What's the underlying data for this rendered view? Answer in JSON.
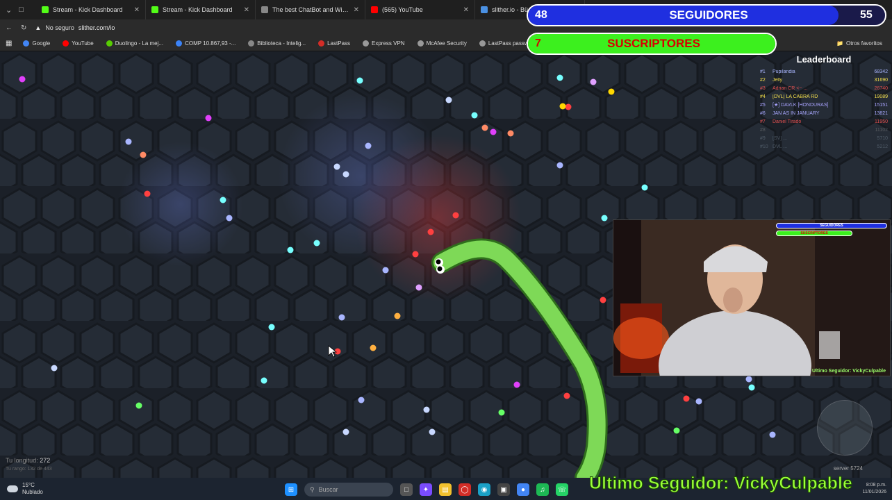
{
  "browser": {
    "tabs": [
      {
        "label": "Stream - Kick Dashboard",
        "icon": "kick-icon",
        "color": "#53fc18"
      },
      {
        "label": "Stream - Kick Dashboard",
        "icon": "kick-icon",
        "color": "#53fc18"
      },
      {
        "label": "The best ChatBot and Widgets for",
        "icon": "chatbot-icon",
        "color": "#888888"
      },
      {
        "label": "(565) YouTube",
        "icon": "youtube-icon",
        "color": "#ff0000"
      },
      {
        "label": "slither.io - Bü",
        "icon": "slither-icon",
        "color": "#4a90e2"
      }
    ],
    "address": {
      "security": "No seguro",
      "url": "slither.com/io"
    },
    "bookmarks": [
      {
        "label": "Google",
        "color": "#4285f4"
      },
      {
        "label": "YouTube",
        "color": "#ff0000"
      },
      {
        "label": "Duolingo - La mej...",
        "color": "#58cc02"
      },
      {
        "label": "COMP 10.867,93 -...",
        "color": "#3b82f6"
      },
      {
        "label": "Biblioteca - Intelig...",
        "color": "#888888"
      },
      {
        "label": "LastPass",
        "color": "#d32d27"
      },
      {
        "label": "Express VPN",
        "color": "#999999"
      },
      {
        "label": "McAfee Security",
        "color": "#999999"
      },
      {
        "label": "LastPass passwor...",
        "color": "#999999"
      }
    ],
    "other_favs": "Otros favoritos"
  },
  "overlay": {
    "followers": {
      "current": "48",
      "label": "SEGUIDORES",
      "goal": "55",
      "fraction": 0.87
    },
    "subscribers": {
      "current": "7",
      "label": "SUSCRIPTORES",
      "fraction": 1.0
    },
    "last_follower": "Ultimo Seguidor: VickyCulpable",
    "webcam_caption": "Ultimo Seguidor: VickyCulpable",
    "webcam_mini_followers": "SEGUIDORES",
    "webcam_mini_subs": "SUSCRIPTORES"
  },
  "game": {
    "leaderboard_title": "Leaderboard",
    "leaderboard": [
      {
        "rank": "#1",
        "name": "Pupilandia",
        "score": "68342",
        "color": "#a9b6ff"
      },
      {
        "rank": "#2",
        "name": "Jelly",
        "score": "31690",
        "color": "#f4e04d"
      },
      {
        "rank": "#3",
        "name": "Adrian CR <~ ...",
        "score": "26740",
        "color": "#e05050"
      },
      {
        "rank": "#4",
        "name": "[DVL] LA CABRA RD",
        "score": "19089",
        "color": "#f4e04d"
      },
      {
        "rank": "#5",
        "name": "[★] DAVLK [HONDURAS]",
        "score": "15151",
        "color": "#a9a3ff"
      },
      {
        "rank": "#6",
        "name": "JAN AS IN JANUARY",
        "score": "13821",
        "color": "#a8a8ff"
      },
      {
        "rank": "#7",
        "name": "Daniel Tirado",
        "score": "11950",
        "color": "#e05050"
      },
      {
        "rank": "#8",
        "name": "",
        "score": "11102",
        "color": "#888888"
      },
      {
        "rank": "#9",
        "name": "[SV] ...",
        "score": "5710",
        "color": "#7a8a9a"
      },
      {
        "rank": "#10",
        "name": "DVL ...",
        "score": "5212",
        "color": "#7a8a9a"
      }
    ],
    "length_label": "Tu longitud:",
    "length_value": "272",
    "rank_text": "Tu rango: 132 de 443",
    "server": "server 5724"
  },
  "taskbar": {
    "weather_temp": "15°C",
    "weather_desc": "Nublado",
    "search_placeholder": "Buscar",
    "time": "8:08 p.m.",
    "date": "11/01/2026"
  }
}
